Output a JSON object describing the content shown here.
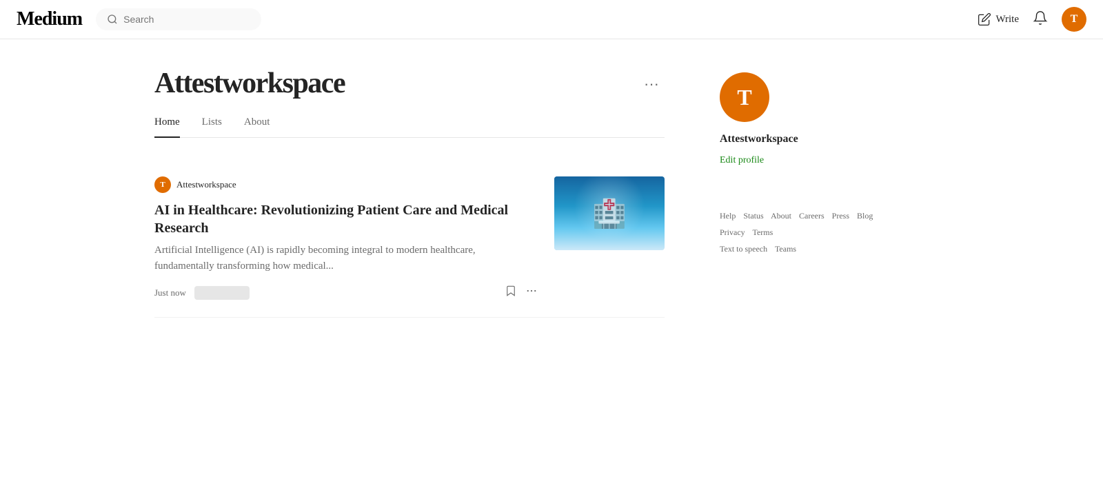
{
  "header": {
    "logo": "Medium",
    "search_placeholder": "Search",
    "write_label": "Write",
    "avatar_letter": "T"
  },
  "profile": {
    "name": "Attestworkspace",
    "tabs": [
      {
        "label": "Home",
        "active": true
      },
      {
        "label": "Lists",
        "active": false
      },
      {
        "label": "About",
        "active": false
      }
    ],
    "sidebar": {
      "avatar_letter": "T",
      "username": "Attestworkspace",
      "edit_label": "Edit profile"
    }
  },
  "article": {
    "author_avatar_letter": "T",
    "author_name": "Attestworkspace",
    "title": "AI in Healthcare: Revolutionizing Patient Care and Medical Research",
    "excerpt": "Artificial Intelligence (AI) is rapidly becoming integral to modern healthcare, fundamentally transforming how medical...",
    "timestamp": "Just now"
  },
  "footer": {
    "links": [
      "Help",
      "Status",
      "About",
      "Careers",
      "Press",
      "Blog",
      "Privacy",
      "Terms",
      "Text to speech",
      "Teams"
    ]
  }
}
